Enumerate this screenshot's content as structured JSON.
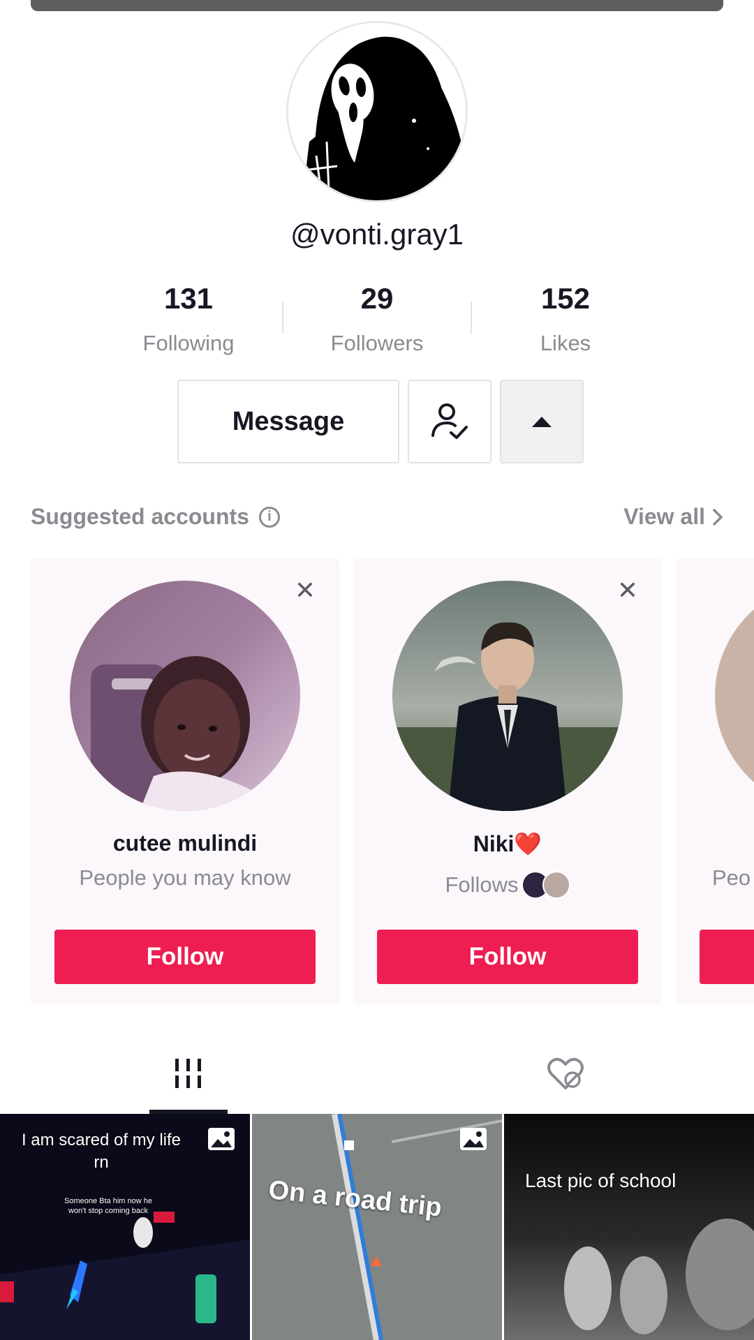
{
  "profile": {
    "username": "@vonti.gray1"
  },
  "stats": [
    {
      "value": "131",
      "label": "Following"
    },
    {
      "value": "29",
      "label": "Followers"
    },
    {
      "value": "152",
      "label": "Likes"
    }
  ],
  "actions": {
    "message_label": "Message",
    "friend_icon": "person-check-icon",
    "more_icon": "caret-up-icon"
  },
  "suggested": {
    "title": "Suggested accounts",
    "view_all": "View all",
    "cards": [
      {
        "name": "cutee mulindi",
        "subtitle": "People you may know",
        "follow_label": "Follow"
      },
      {
        "name": "Niki❤️",
        "subtitle": "Follows",
        "follow_label": "Follow"
      },
      {
        "subtitle": "Peo"
      }
    ]
  },
  "tabs": [
    {
      "icon": "grid-icon"
    },
    {
      "icon": "liked-hidden-icon"
    }
  ],
  "videos": [
    {
      "caption": "I am scared of my life rn",
      "overlay": "Someone Bta him now he won't stop coming back",
      "type": "photo"
    },
    {
      "caption": "On a road trip",
      "type": "photo"
    },
    {
      "caption": "Last pic of school"
    }
  ],
  "colors": {
    "follow": "#ee1d52",
    "text": "#161823",
    "muted": "#8a8b91"
  }
}
